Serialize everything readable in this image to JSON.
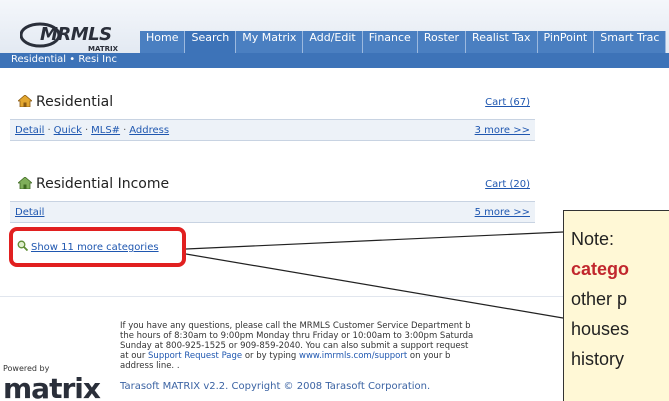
{
  "header": {
    "logo_text": "MRMLS",
    "logo_sub": "MATRIX",
    "nav": [
      "Home",
      "Search",
      "My Matrix",
      "Add/Edit",
      "Finance",
      "Roster",
      "Realist Tax",
      "PinPoint",
      "Smart Trac"
    ],
    "active_nav": "Search",
    "breadcrumb": "Residential • Resi Inc"
  },
  "panels": [
    {
      "title": "Residential",
      "cart": "Cart (67)",
      "links": [
        "Detail",
        "Quick",
        "MLS#",
        "Address"
      ],
      "more": "3 more >>"
    },
    {
      "title": "Residential Income",
      "cart": "Cart (20)",
      "links": [
        "Detail"
      ],
      "more": "5 more >>"
    }
  ],
  "show_more": "Show 11 more categories",
  "footer": {
    "line1": "If you have any questions, please call the MRMLS Customer Service Department b",
    "line2": "the hours of 8:30am to 9:00pm Monday thru Friday or 10:00am to 3:00pm Saturda",
    "line3": "Sunday at 800-925-1525 or 909-859-2040. You can also submit a support request",
    "line4_pre": "at our ",
    "line4_link": "Support Request Page",
    "line4_mid": " or by typing ",
    "line4_url": "www.imrmls.com/support",
    "line4_post": " on your b",
    "line5": "address line. .",
    "copyright": "Tarasoft MATRIX v2.2. Copyright © 2008 Tarasoft Corporation.",
    "powered_by": "Powered by",
    "matrix_logo": "matrix"
  },
  "callout": {
    "note": "Note: ",
    "bold": "catego",
    "line3": "other p",
    "line4": "houses",
    "line5": "history"
  },
  "colors": {
    "nav_bg": "#4a7fc1",
    "link": "#1f57b0",
    "highlight": "#e12020",
    "callout_bg": "#fff8d6"
  }
}
